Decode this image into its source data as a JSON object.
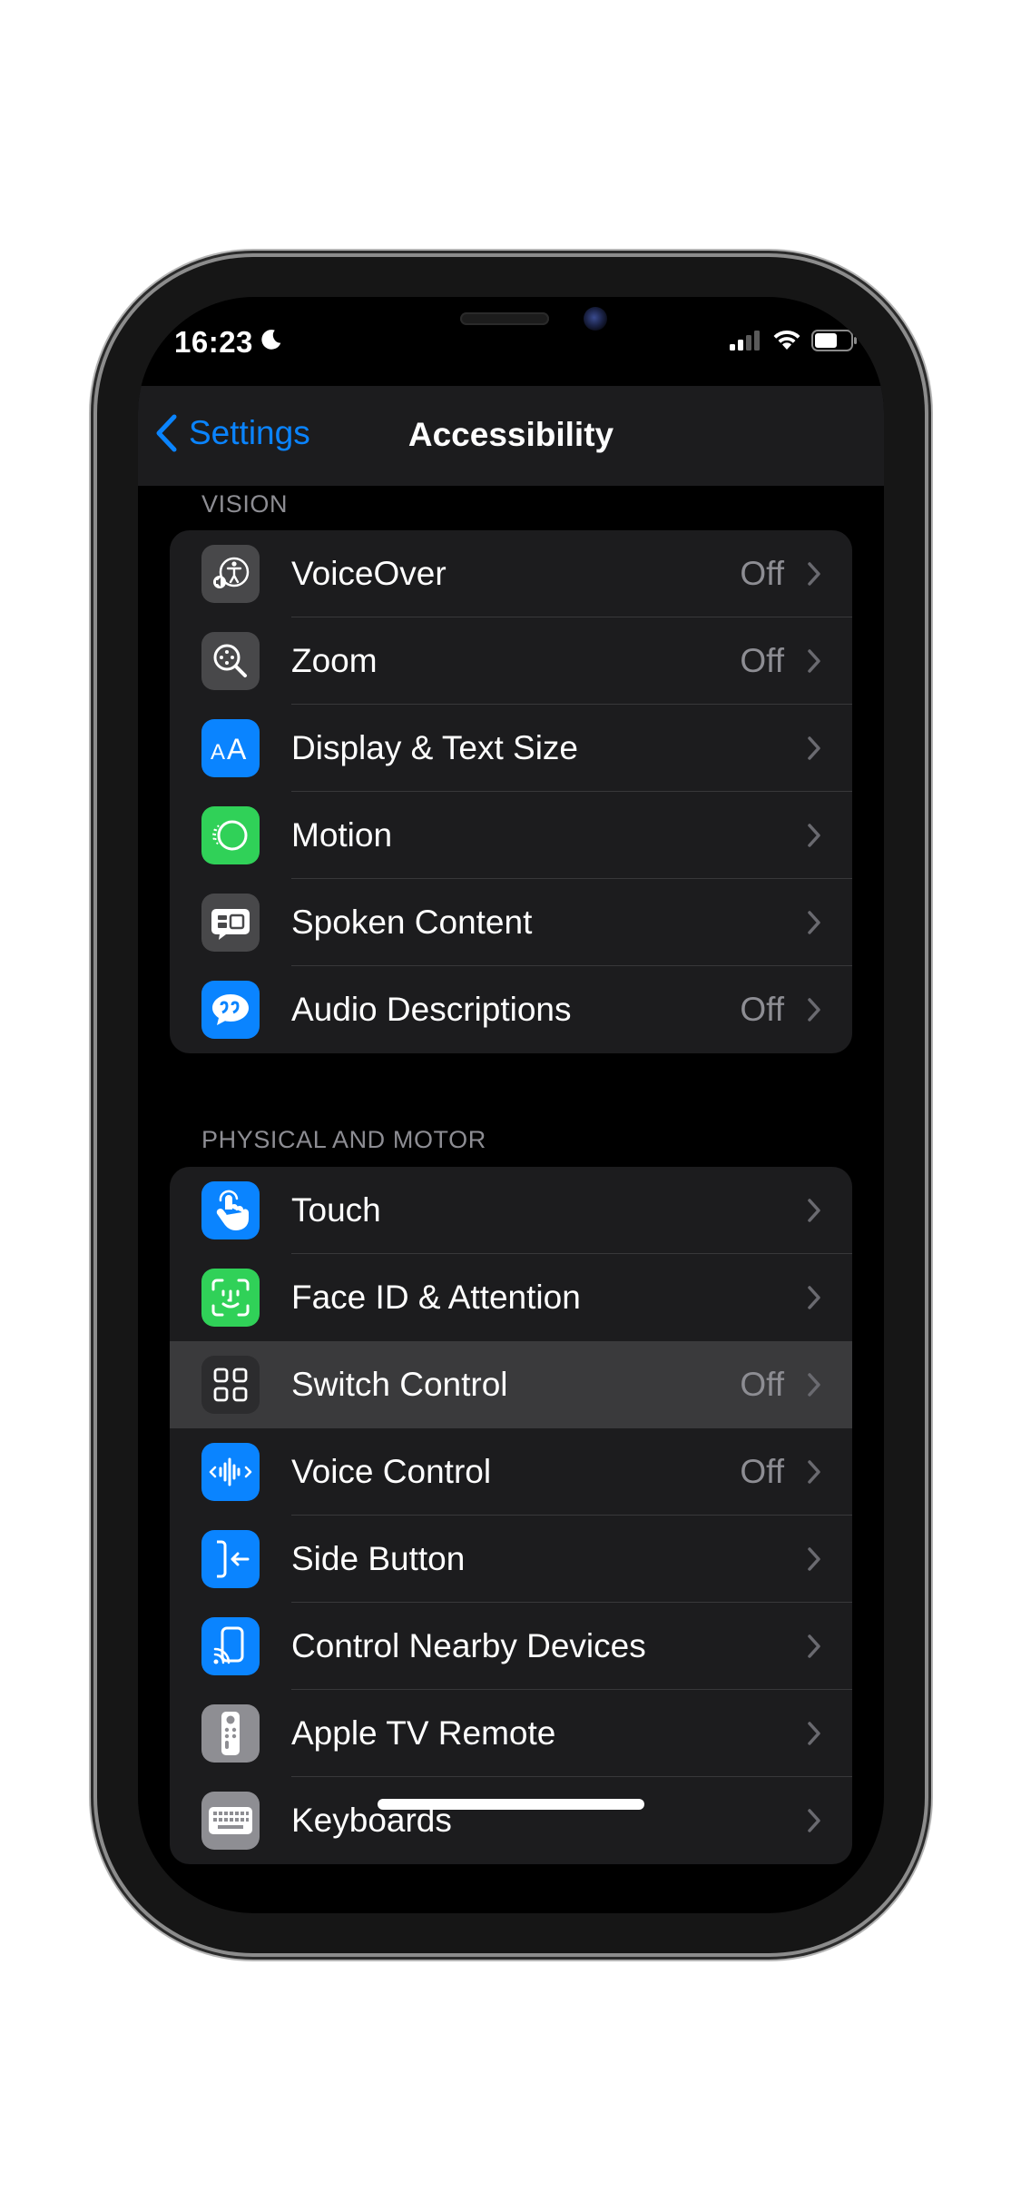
{
  "status_bar": {
    "time": "16:23"
  },
  "nav": {
    "back_label": "Settings",
    "title": "Accessibility"
  },
  "sections": [
    {
      "header": "VISION",
      "items": [
        {
          "label": "VoiceOver",
          "value": "Off",
          "icon": "voiceover-icon",
          "color": "#48484a"
        },
        {
          "label": "Zoom",
          "value": "Off",
          "icon": "zoom-icon",
          "color": "#48484a"
        },
        {
          "label": "Display & Text Size",
          "value": "",
          "icon": "text-size-icon",
          "color": "#0a84ff"
        },
        {
          "label": "Motion",
          "value": "",
          "icon": "motion-icon",
          "color": "#30d158"
        },
        {
          "label": "Spoken Content",
          "value": "",
          "icon": "spoken-content-icon",
          "color": "#48484a"
        },
        {
          "label": "Audio Descriptions",
          "value": "Off",
          "icon": "audio-descriptions-icon",
          "color": "#0a84ff"
        }
      ]
    },
    {
      "header": "PHYSICAL AND MOTOR",
      "items": [
        {
          "label": "Touch",
          "value": "",
          "icon": "touch-icon",
          "color": "#0a84ff"
        },
        {
          "label": "Face ID & Attention",
          "value": "",
          "icon": "face-id-icon",
          "color": "#30d158"
        },
        {
          "label": "Switch Control",
          "value": "Off",
          "icon": "switch-control-icon",
          "color": "#3a3a3c"
        },
        {
          "label": "Voice Control",
          "value": "Off",
          "icon": "voice-control-icon",
          "color": "#0a84ff"
        },
        {
          "label": "Side Button",
          "value": "",
          "icon": "side-button-icon",
          "color": "#0a84ff"
        },
        {
          "label": "Control Nearby Devices",
          "value": "",
          "icon": "nearby-devices-icon",
          "color": "#0a84ff"
        },
        {
          "label": "Apple TV Remote",
          "value": "",
          "icon": "tv-remote-icon",
          "color": "#8e8e93"
        },
        {
          "label": "Keyboards",
          "value": "",
          "icon": "keyboard-icon",
          "color": "#8e8e93"
        }
      ]
    }
  ],
  "colors": {
    "accent": "#0a84ff",
    "background": "#000000",
    "cell": "#1c1c1e",
    "highlight": "#3a3a3c",
    "secondary_text": "#8d8d93"
  }
}
